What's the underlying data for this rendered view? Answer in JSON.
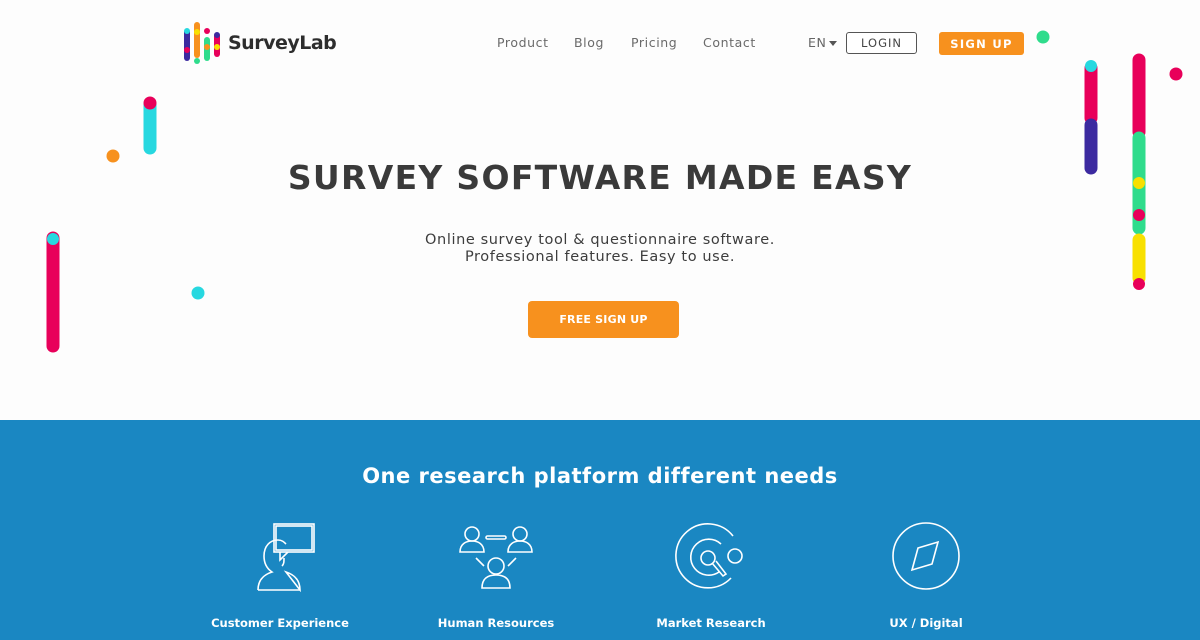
{
  "brand": {
    "name": "SurveyLab"
  },
  "nav": {
    "links": [
      "Product",
      "Blog",
      "Pricing",
      "Contact"
    ],
    "language": "EN",
    "login_label": "LOGIN",
    "signup_label": "SIGN UP"
  },
  "hero": {
    "headline": "SURVEY SOFTWARE MADE EASY",
    "subtitle_line1": "Online survey tool & questionnaire software.",
    "subtitle_line2": "Professional features. Easy to use.",
    "cta_label": "FREE SIGN UP"
  },
  "platform": {
    "title": "One research platform different needs",
    "features": [
      {
        "label": "Customer Experience",
        "icon": "customer-speech-icon"
      },
      {
        "label": "Human Resources",
        "icon": "people-network-icon"
      },
      {
        "label": "Market Research",
        "icon": "target-research-icon"
      },
      {
        "label": "UX / Digital",
        "icon": "compass-icon"
      }
    ]
  },
  "colors": {
    "accent_orange": "#f7911e",
    "platform_blue": "#1a87c2",
    "magenta": "#e8005a",
    "cyan": "#27d8e0",
    "green": "#2fdc8c",
    "yellow": "#f8e000",
    "indigo": "#3c2aa0"
  }
}
